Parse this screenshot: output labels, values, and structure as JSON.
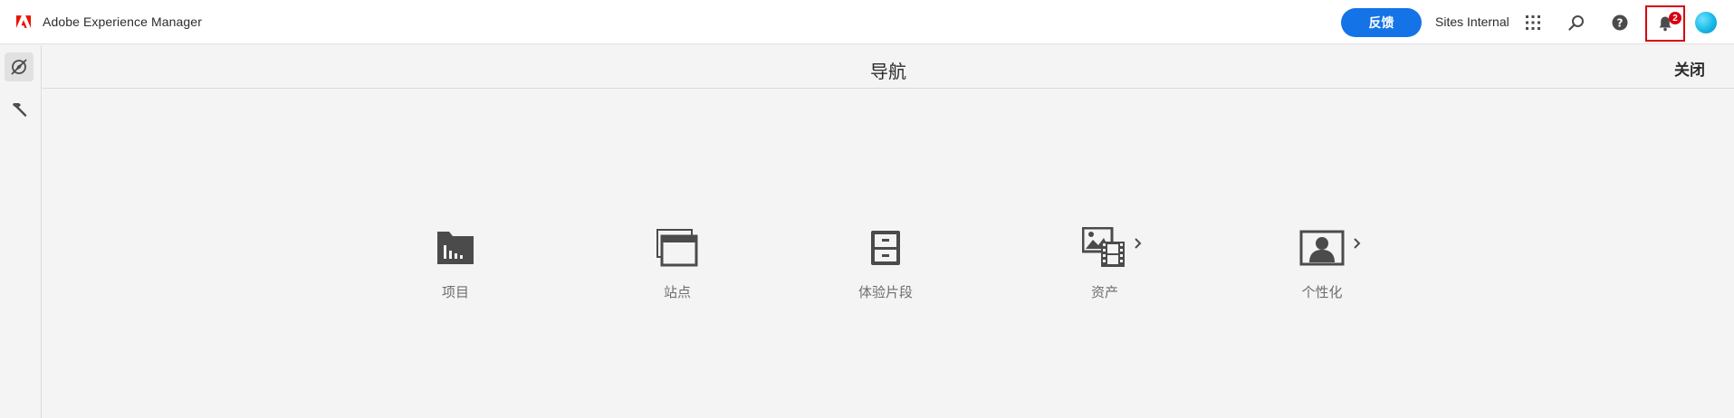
{
  "header": {
    "app_name": "Adobe Experience Manager",
    "feedback_label": "反馈",
    "org_name": "Sites Internal",
    "notification_count": "2",
    "colors": {
      "accent": "#1473e6",
      "adobe_red": "#eb1000",
      "badge": "#d7000f"
    }
  },
  "rail": {
    "items": [
      {
        "icon": "compass-icon",
        "active": true
      },
      {
        "icon": "hammer-icon",
        "active": false
      }
    ]
  },
  "navigation": {
    "title": "导航",
    "close_label": "关闭",
    "tiles": [
      {
        "label": "项目",
        "icon": "projects-folder-icon",
        "has_submenu": false
      },
      {
        "label": "站点",
        "icon": "sites-windows-icon",
        "has_submenu": false
      },
      {
        "label": "体验片段",
        "icon": "experience-fragments-icon",
        "has_submenu": false
      },
      {
        "label": "资产",
        "icon": "assets-icon",
        "has_submenu": true
      },
      {
        "label": "个性化",
        "icon": "personalization-icon",
        "has_submenu": true
      }
    ]
  }
}
